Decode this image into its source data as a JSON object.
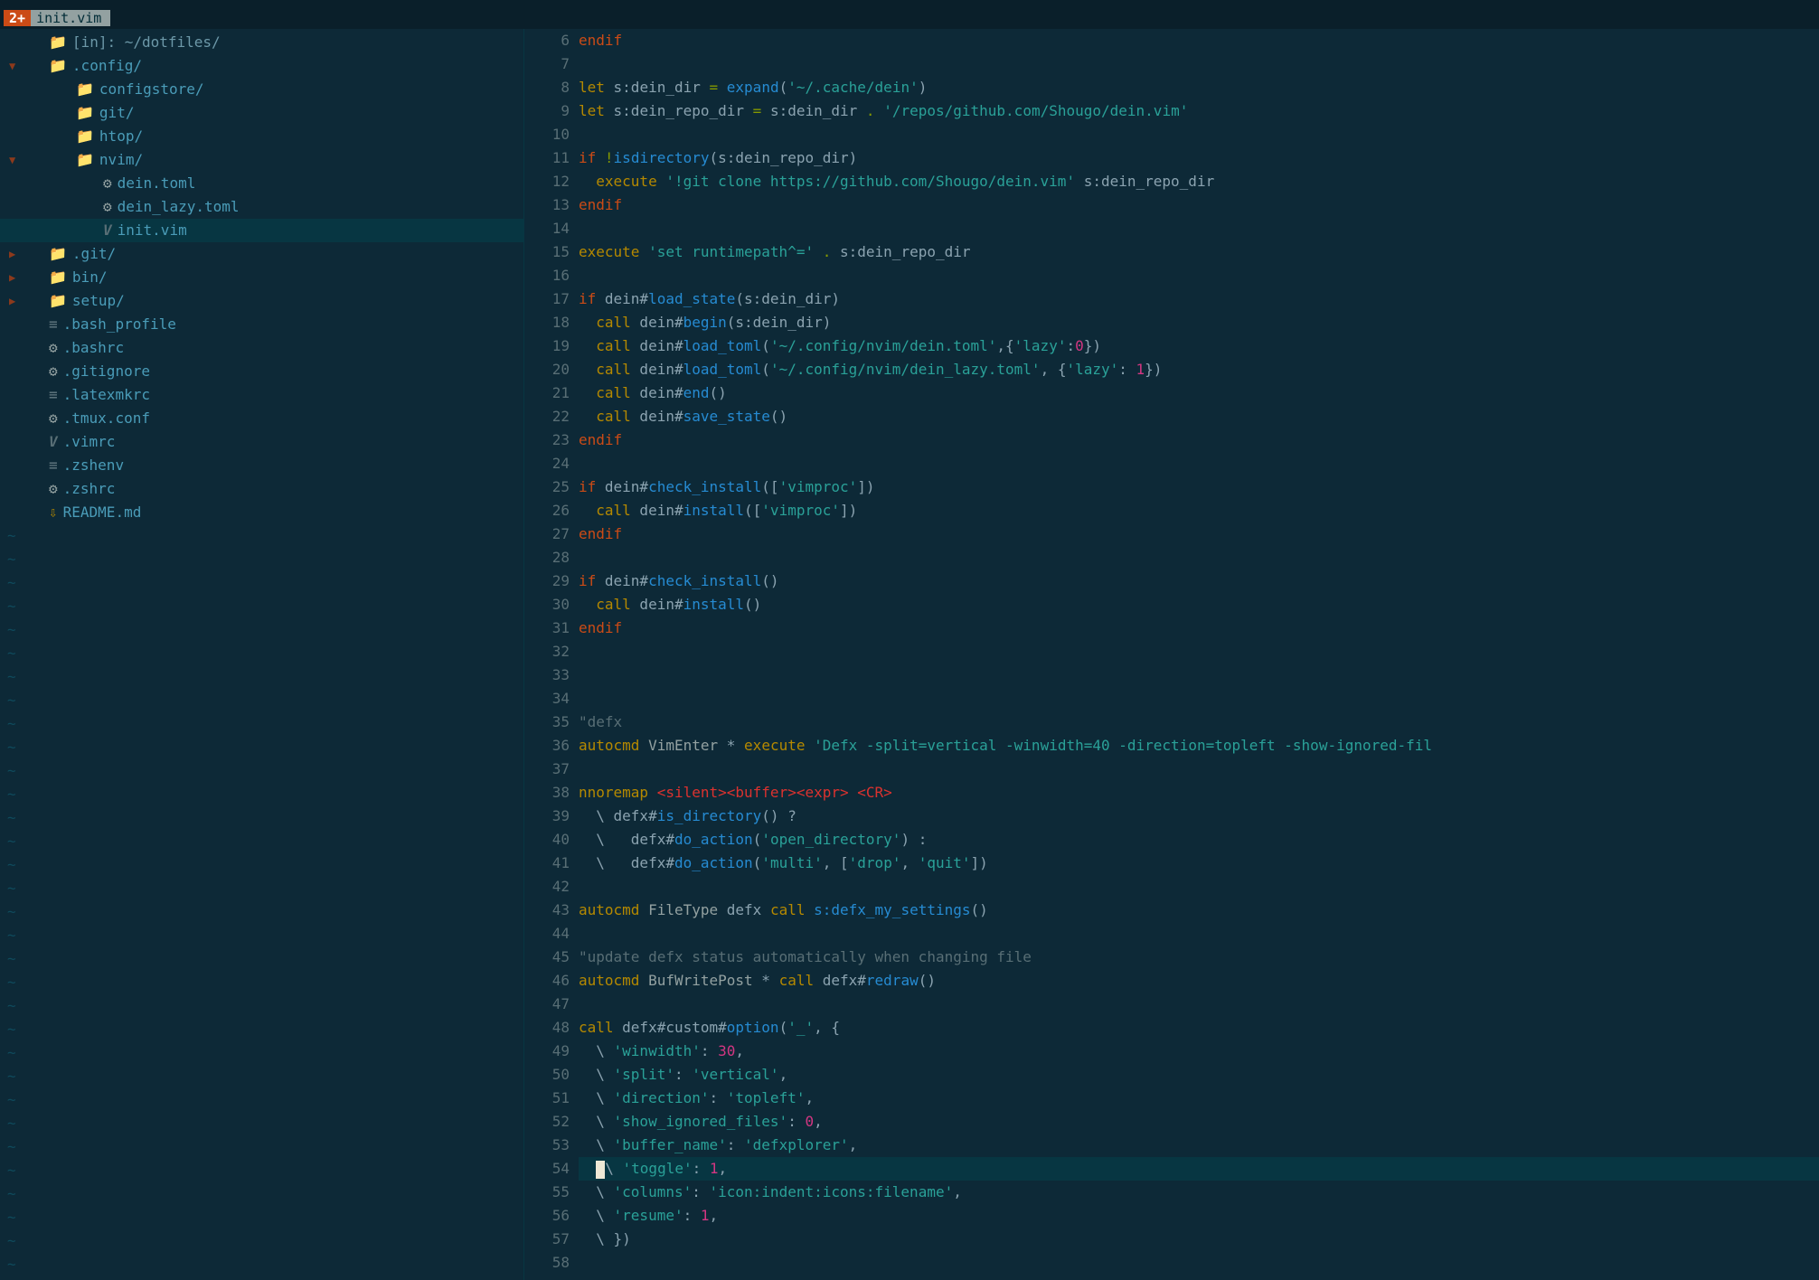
{
  "tab": {
    "badge": "2+",
    "name": " init.vim "
  },
  "tree": [
    {
      "depth": 0,
      "arrow": "none",
      "icon": "folder",
      "text": "[in]: ~/dotfiles/",
      "cls": "root-text"
    },
    {
      "depth": 0,
      "arrow": "open",
      "icon": "folder",
      "text": ".config/"
    },
    {
      "depth": 1,
      "arrow": "none",
      "icon": "folder",
      "text": "configstore/"
    },
    {
      "depth": 1,
      "arrow": "none",
      "icon": "folder",
      "text": "git/"
    },
    {
      "depth": 1,
      "arrow": "none",
      "icon": "folder",
      "text": "htop/"
    },
    {
      "depth": 1,
      "arrow": "open",
      "icon": "folder",
      "text": "nvim/"
    },
    {
      "depth": 2,
      "arrow": "none",
      "icon": "gear",
      "text": "dein.toml"
    },
    {
      "depth": 2,
      "arrow": "none",
      "icon": "gear",
      "text": "dein_lazy.toml"
    },
    {
      "depth": 2,
      "arrow": "none",
      "icon": "vim",
      "text": "init.vim",
      "selected": true
    },
    {
      "depth": 0,
      "arrow": "closed",
      "icon": "folder",
      "text": ".git/"
    },
    {
      "depth": 0,
      "arrow": "closed",
      "icon": "folder",
      "text": "bin/"
    },
    {
      "depth": 0,
      "arrow": "closed",
      "icon": "folder",
      "text": "setup/"
    },
    {
      "depth": 0,
      "arrow": "none",
      "icon": "file",
      "text": ".bash_profile"
    },
    {
      "depth": 0,
      "arrow": "none",
      "icon": "gear",
      "text": ".bashrc"
    },
    {
      "depth": 0,
      "arrow": "none",
      "icon": "gear",
      "text": ".gitignore"
    },
    {
      "depth": 0,
      "arrow": "none",
      "icon": "file",
      "text": ".latexmkrc"
    },
    {
      "depth": 0,
      "arrow": "none",
      "icon": "gear",
      "text": ".tmux.conf"
    },
    {
      "depth": 0,
      "arrow": "none",
      "icon": "vim",
      "text": ".vimrc"
    },
    {
      "depth": 0,
      "arrow": "none",
      "icon": "file",
      "text": ".zshenv"
    },
    {
      "depth": 0,
      "arrow": "none",
      "icon": "gear",
      "text": ".zshrc"
    },
    {
      "depth": 0,
      "arrow": "none",
      "icon": "md",
      "text": "README.md"
    }
  ],
  "tildes_count": 32,
  "first_line_number": 6,
  "cursor_line": 54,
  "code": [
    [
      {
        "t": "endif",
        "c": "orange"
      }
    ],
    [],
    [
      {
        "t": "let",
        "c": "yellow"
      },
      {
        "t": " s:dein_dir ",
        "c": "base"
      },
      {
        "t": "=",
        "c": "green"
      },
      {
        "t": " ",
        "c": "base"
      },
      {
        "t": "expand",
        "c": "blue"
      },
      {
        "t": "(",
        "c": "base"
      },
      {
        "t": "'~/.cache/dein'",
        "c": "cyan"
      },
      {
        "t": ")",
        "c": "base"
      }
    ],
    [
      {
        "t": "let",
        "c": "yellow"
      },
      {
        "t": " s:dein_repo_dir ",
        "c": "base"
      },
      {
        "t": "=",
        "c": "green"
      },
      {
        "t": " s:dein_dir ",
        "c": "base"
      },
      {
        "t": ".",
        "c": "green"
      },
      {
        "t": " ",
        "c": "base"
      },
      {
        "t": "'/repos/github.com/Shougo/dein.vim'",
        "c": "cyan"
      }
    ],
    [],
    [
      {
        "t": "if",
        "c": "orange"
      },
      {
        "t": " ",
        "c": "base"
      },
      {
        "t": "!",
        "c": "green"
      },
      {
        "t": "isdirectory",
        "c": "blue"
      },
      {
        "t": "(",
        "c": "base"
      },
      {
        "t": "s:dein_repo_dir",
        "c": "base"
      },
      {
        "t": ")",
        "c": "base"
      }
    ],
    [
      {
        "t": "  execute ",
        "c": "yellow"
      },
      {
        "t": "'!git clone https://github.com/Shougo/dein.vim'",
        "c": "cyan"
      },
      {
        "t": " s:dein_repo_dir",
        "c": "base"
      }
    ],
    [
      {
        "t": "endif",
        "c": "orange"
      }
    ],
    [],
    [
      {
        "t": "execute ",
        "c": "yellow"
      },
      {
        "t": "'set runtimepath^='",
        "c": "cyan"
      },
      {
        "t": " ",
        "c": "base"
      },
      {
        "t": ".",
        "c": "green"
      },
      {
        "t": " s:dein_repo_dir",
        "c": "base"
      }
    ],
    [],
    [
      {
        "t": "if",
        "c": "orange"
      },
      {
        "t": " dein#",
        "c": "base"
      },
      {
        "t": "load_state",
        "c": "blue"
      },
      {
        "t": "(",
        "c": "base"
      },
      {
        "t": "s:dein_dir",
        "c": "base"
      },
      {
        "t": ")",
        "c": "base"
      }
    ],
    [
      {
        "t": "  ",
        "c": "base"
      },
      {
        "t": "call",
        "c": "yellow"
      },
      {
        "t": " dein#",
        "c": "base"
      },
      {
        "t": "begin",
        "c": "blue"
      },
      {
        "t": "(",
        "c": "base"
      },
      {
        "t": "s:dein_dir",
        "c": "base"
      },
      {
        "t": ")",
        "c": "base"
      }
    ],
    [
      {
        "t": "  ",
        "c": "base"
      },
      {
        "t": "call",
        "c": "yellow"
      },
      {
        "t": " dein#",
        "c": "base"
      },
      {
        "t": "load_toml",
        "c": "blue"
      },
      {
        "t": "(",
        "c": "base"
      },
      {
        "t": "'~/.config/nvim/dein.toml'",
        "c": "cyan"
      },
      {
        "t": ",{",
        "c": "base"
      },
      {
        "t": "'lazy'",
        "c": "cyan"
      },
      {
        "t": ":",
        "c": "base"
      },
      {
        "t": "0",
        "c": "magenta"
      },
      {
        "t": "})",
        "c": "base"
      }
    ],
    [
      {
        "t": "  ",
        "c": "base"
      },
      {
        "t": "call",
        "c": "yellow"
      },
      {
        "t": " dein#",
        "c": "base"
      },
      {
        "t": "load_toml",
        "c": "blue"
      },
      {
        "t": "(",
        "c": "base"
      },
      {
        "t": "'~/.config/nvim/dein_lazy.toml'",
        "c": "cyan"
      },
      {
        "t": ", {",
        "c": "base"
      },
      {
        "t": "'lazy'",
        "c": "cyan"
      },
      {
        "t": ": ",
        "c": "base"
      },
      {
        "t": "1",
        "c": "magenta"
      },
      {
        "t": "})",
        "c": "base"
      }
    ],
    [
      {
        "t": "  ",
        "c": "base"
      },
      {
        "t": "call",
        "c": "yellow"
      },
      {
        "t": " dein#",
        "c": "base"
      },
      {
        "t": "end",
        "c": "blue"
      },
      {
        "t": "()",
        "c": "base"
      }
    ],
    [
      {
        "t": "  ",
        "c": "base"
      },
      {
        "t": "call",
        "c": "yellow"
      },
      {
        "t": " dein#",
        "c": "base"
      },
      {
        "t": "save_state",
        "c": "blue"
      },
      {
        "t": "()",
        "c": "base"
      }
    ],
    [
      {
        "t": "endif",
        "c": "orange"
      }
    ],
    [],
    [
      {
        "t": "if",
        "c": "orange"
      },
      {
        "t": " dein#",
        "c": "base"
      },
      {
        "t": "check_install",
        "c": "blue"
      },
      {
        "t": "([",
        "c": "base"
      },
      {
        "t": "'vimproc'",
        "c": "cyan"
      },
      {
        "t": "])",
        "c": "base"
      }
    ],
    [
      {
        "t": "  ",
        "c": "base"
      },
      {
        "t": "call",
        "c": "yellow"
      },
      {
        "t": " dein#",
        "c": "base"
      },
      {
        "t": "install",
        "c": "blue"
      },
      {
        "t": "([",
        "c": "base"
      },
      {
        "t": "'vimproc'",
        "c": "cyan"
      },
      {
        "t": "])",
        "c": "base"
      }
    ],
    [
      {
        "t": "endif",
        "c": "orange"
      }
    ],
    [],
    [
      {
        "t": "if",
        "c": "orange"
      },
      {
        "t": " dein#",
        "c": "base"
      },
      {
        "t": "check_install",
        "c": "blue"
      },
      {
        "t": "()",
        "c": "base"
      }
    ],
    [
      {
        "t": "  ",
        "c": "base"
      },
      {
        "t": "call",
        "c": "yellow"
      },
      {
        "t": " dein#",
        "c": "base"
      },
      {
        "t": "install",
        "c": "blue"
      },
      {
        "t": "()",
        "c": "base"
      }
    ],
    [
      {
        "t": "endif",
        "c": "orange"
      }
    ],
    [],
    [],
    [],
    [
      {
        "t": "\"defx",
        "c": "grey"
      }
    ],
    [
      {
        "t": "autocmd",
        "c": "yellow"
      },
      {
        "t": " ",
        "c": "base"
      },
      {
        "t": "VimEnter",
        "c": "bright"
      },
      {
        "t": " * ",
        "c": "base"
      },
      {
        "t": "execute ",
        "c": "yellow"
      },
      {
        "t": "'Defx -split=vertical -winwidth=40 -direction=topleft -show-ignored-fil",
        "c": "cyan"
      }
    ],
    [],
    [
      {
        "t": "nnoremap",
        "c": "yellow"
      },
      {
        "t": " ",
        "c": "base"
      },
      {
        "t": "<silent><buffer><expr>",
        "c": "red"
      },
      {
        "t": " ",
        "c": "base"
      },
      {
        "t": "<CR>",
        "c": "red"
      }
    ],
    [
      {
        "t": "  \\ defx#",
        "c": "base"
      },
      {
        "t": "is_directory",
        "c": "blue"
      },
      {
        "t": "() ",
        "c": "base"
      },
      {
        "t": "?",
        "c": "base"
      }
    ],
    [
      {
        "t": "  \\   defx#",
        "c": "base"
      },
      {
        "t": "do_action",
        "c": "blue"
      },
      {
        "t": "(",
        "c": "base"
      },
      {
        "t": "'open_directory'",
        "c": "cyan"
      },
      {
        "t": ") :",
        "c": "base"
      }
    ],
    [
      {
        "t": "  \\   defx#",
        "c": "base"
      },
      {
        "t": "do_action",
        "c": "blue"
      },
      {
        "t": "(",
        "c": "base"
      },
      {
        "t": "'multi'",
        "c": "cyan"
      },
      {
        "t": ", [",
        "c": "base"
      },
      {
        "t": "'drop'",
        "c": "cyan"
      },
      {
        "t": ", ",
        "c": "base"
      },
      {
        "t": "'quit'",
        "c": "cyan"
      },
      {
        "t": "])",
        "c": "base"
      }
    ],
    [],
    [
      {
        "t": "autocmd",
        "c": "yellow"
      },
      {
        "t": " ",
        "c": "base"
      },
      {
        "t": "FileType",
        "c": "bright"
      },
      {
        "t": " defx ",
        "c": "base"
      },
      {
        "t": "call",
        "c": "yellow"
      },
      {
        "t": " ",
        "c": "base"
      },
      {
        "t": "s:defx_my_settings",
        "c": "blue"
      },
      {
        "t": "()",
        "c": "base"
      }
    ],
    [],
    [
      {
        "t": "\"update defx status automatically when changing file",
        "c": "grey"
      }
    ],
    [
      {
        "t": "autocmd",
        "c": "yellow"
      },
      {
        "t": " ",
        "c": "base"
      },
      {
        "t": "BufWritePost",
        "c": "bright"
      },
      {
        "t": " * ",
        "c": "base"
      },
      {
        "t": "call",
        "c": "yellow"
      },
      {
        "t": " defx#",
        "c": "base"
      },
      {
        "t": "redraw",
        "c": "blue"
      },
      {
        "t": "()",
        "c": "base"
      }
    ],
    [],
    [
      {
        "t": "call",
        "c": "yellow"
      },
      {
        "t": " defx#custom#",
        "c": "base"
      },
      {
        "t": "option",
        "c": "blue"
      },
      {
        "t": "(",
        "c": "base"
      },
      {
        "t": "'_'",
        "c": "cyan"
      },
      {
        "t": ", {",
        "c": "base"
      }
    ],
    [
      {
        "t": "  \\ ",
        "c": "base"
      },
      {
        "t": "'winwidth'",
        "c": "cyan"
      },
      {
        "t": ": ",
        "c": "base"
      },
      {
        "t": "30",
        "c": "magenta"
      },
      {
        "t": ",",
        "c": "base"
      }
    ],
    [
      {
        "t": "  \\ ",
        "c": "base"
      },
      {
        "t": "'split'",
        "c": "cyan"
      },
      {
        "t": ": ",
        "c": "base"
      },
      {
        "t": "'vertical'",
        "c": "cyan"
      },
      {
        "t": ",",
        "c": "base"
      }
    ],
    [
      {
        "t": "  \\ ",
        "c": "base"
      },
      {
        "t": "'direction'",
        "c": "cyan"
      },
      {
        "t": ": ",
        "c": "base"
      },
      {
        "t": "'topleft'",
        "c": "cyan"
      },
      {
        "t": ",",
        "c": "base"
      }
    ],
    [
      {
        "t": "  \\ ",
        "c": "base"
      },
      {
        "t": "'show_ignored_files'",
        "c": "cyan"
      },
      {
        "t": ": ",
        "c": "base"
      },
      {
        "t": "0",
        "c": "magenta"
      },
      {
        "t": ",",
        "c": "base"
      }
    ],
    [
      {
        "t": "  \\ ",
        "c": "base"
      },
      {
        "t": "'buffer_name'",
        "c": "cyan"
      },
      {
        "t": ": ",
        "c": "base"
      },
      {
        "t": "'defxplorer'",
        "c": "cyan"
      },
      {
        "t": ",",
        "c": "base"
      }
    ],
    [
      {
        "t": "  ",
        "c": "base"
      },
      {
        "t": "CURSOR",
        "c": "cursor"
      },
      {
        "t": "\\ ",
        "c": "base"
      },
      {
        "t": "'toggle'",
        "c": "cyan"
      },
      {
        "t": ": ",
        "c": "base"
      },
      {
        "t": "1",
        "c": "magenta"
      },
      {
        "t": ",",
        "c": "base"
      }
    ],
    [
      {
        "t": "  \\ ",
        "c": "base"
      },
      {
        "t": "'columns'",
        "c": "cyan"
      },
      {
        "t": ": ",
        "c": "base"
      },
      {
        "t": "'icon:indent:icons:filename'",
        "c": "cyan"
      },
      {
        "t": ",",
        "c": "base"
      }
    ],
    [
      {
        "t": "  \\ ",
        "c": "base"
      },
      {
        "t": "'resume'",
        "c": "cyan"
      },
      {
        "t": ": ",
        "c": "base"
      },
      {
        "t": "1",
        "c": "magenta"
      },
      {
        "t": ",",
        "c": "base"
      }
    ],
    [
      {
        "t": "  \\ })",
        "c": "base"
      }
    ],
    []
  ]
}
